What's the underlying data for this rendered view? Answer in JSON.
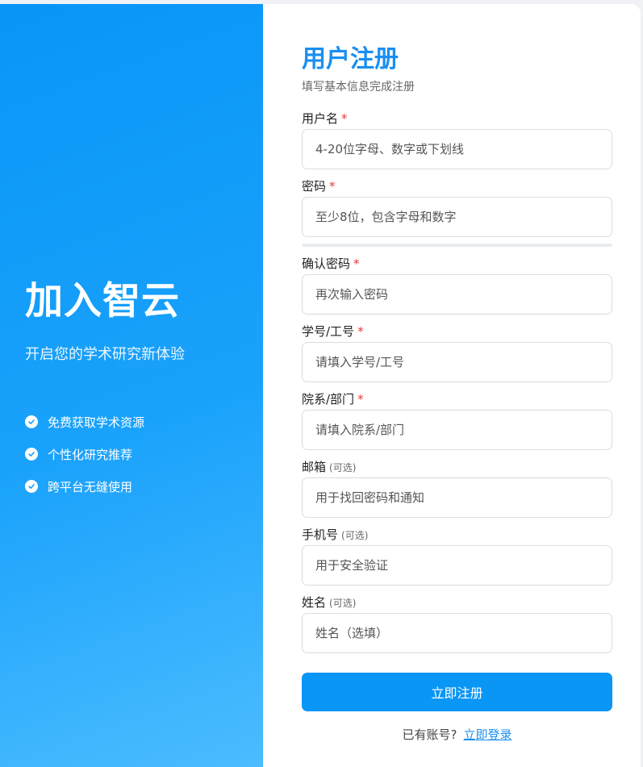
{
  "left_panel": {
    "title": "加入智云",
    "subtitle": "开启您的学术研究新体验",
    "features": [
      "免费获取学术资源",
      "个性化研究推荐",
      "跨平台无缝使用"
    ]
  },
  "form": {
    "title": "用户注册",
    "subtitle": "填写基本信息完成注册",
    "required_mark": "*",
    "optional_mark": "(可选)",
    "fields": {
      "username": {
        "label": "用户名",
        "placeholder": "4-20位字母、数字或下划线",
        "value": ""
      },
      "password": {
        "label": "密码",
        "placeholder": "至少8位，包含字母和数字",
        "value": ""
      },
      "confirm_password": {
        "label": "确认密码",
        "placeholder": "再次输入密码",
        "value": ""
      },
      "student_id": {
        "label": "学号/工号",
        "placeholder": "请填入学号/工号",
        "value": ""
      },
      "department": {
        "label": "院系/部门",
        "placeholder": "请填入院系/部门",
        "value": ""
      },
      "email": {
        "label": "邮箱",
        "placeholder": "用于找回密码和通知",
        "value": ""
      },
      "phone": {
        "label": "手机号",
        "placeholder": "用于安全验证",
        "value": ""
      },
      "name": {
        "label": "姓名",
        "placeholder": "姓名（选填）",
        "value": ""
      }
    },
    "submit_label": "立即注册",
    "login_prompt": "已有账号?",
    "login_link": "立即登录"
  },
  "colors": {
    "accent": "#0a96f5",
    "title_blue": "#1a8ff0",
    "required_red": "#e53935",
    "panel_gradient_start": "#0896f7",
    "panel_gradient_end": "#4bbcff"
  },
  "icons": {
    "feature_bullet": "check-circle-icon"
  }
}
